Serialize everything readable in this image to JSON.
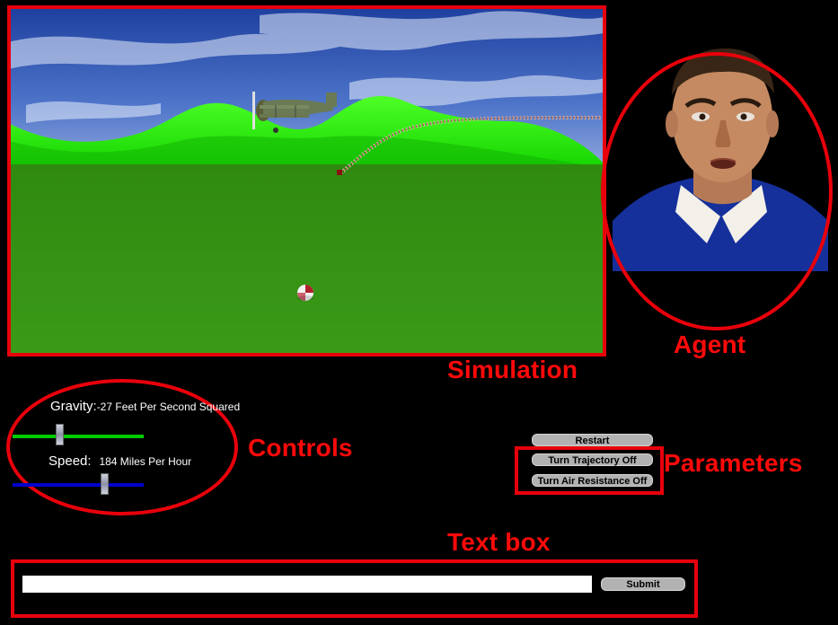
{
  "callouts": {
    "simulation": "Simulation",
    "agent": "Agent",
    "controls": "Controls",
    "parameters": "Parameters",
    "text_box": "Text box"
  },
  "controls": {
    "gravity_label": "Gravity:",
    "gravity_value": "-27 Feet Per Second Squared",
    "gravity_slider_color": "#00cc00",
    "speed_label": "Speed:",
    "speed_value": "184 Miles Per Hour",
    "speed_slider_color": "#0000cc"
  },
  "parameters": {
    "restart_label": "Restart",
    "trajectory_label": "Turn Trajectory Off",
    "air_resistance_label": "Turn Air Resistance Off"
  },
  "text_box": {
    "input_value": "",
    "submit_label": "Submit"
  },
  "colors": {
    "annotation_red": "#e8000b",
    "ground_green": "#2f8a10",
    "hill_green": "#18e000",
    "sky_blue": "#2a4fb0"
  }
}
